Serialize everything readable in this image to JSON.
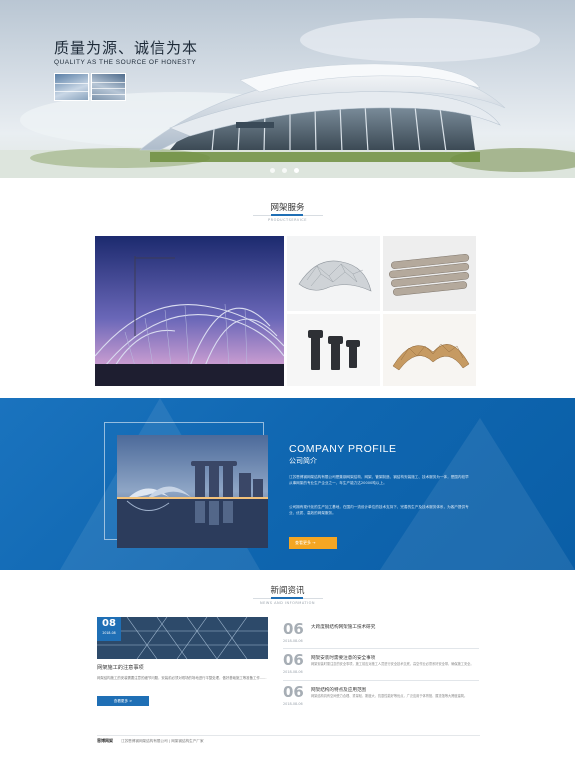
{
  "hero": {
    "title": "质量为源、诚信为本",
    "subtitle": "QUALITY AS THE SOURCE OF HONESTY",
    "thumbnails": [
      "building-photo",
      "building-photo"
    ],
    "slide_count": 3,
    "active_slide": 2
  },
  "products_section": {
    "title": "网架服务",
    "subtitle": "PRODUCTSERVICE",
    "items": [
      {
        "image": "stadium-steel-arch-photo"
      },
      {
        "image": "space-frame-model-photo"
      },
      {
        "image": "steel-pipes-photo"
      },
      {
        "image": "bolts-photo"
      },
      {
        "image": "wood-lattice-model-photo"
      }
    ]
  },
  "profile": {
    "title": "COMPANY PROFILE",
    "subtitle": "公司简介",
    "paragraph_1": "江苏恩博钢网架结构有限公司是集钢网架结构、网架、管架制造、钢结构安装施工、技术服务为一体，是国内较早从事网架的专业生产企业之一，年生产能力达20000吨以上。",
    "paragraph_2": "公司拥有现代化的生产加工基地，在国内一流设计单位的技术支持下，完善的生产及技术服务体系，为客户提供专业、优质、高效的网架服务。",
    "more_label": "查看更多 →",
    "image": "marina-bay-skyline-photo"
  },
  "news_section": {
    "title": "新闻资讯",
    "subtitle": "NEWS AND INFORMATION",
    "feature": {
      "day": "08",
      "month": "2018-08",
      "title": "网架施工的注意事项",
      "text": "网架结构施工的安装需要注意的细节问题，安装前必须对现场的场地进行平整处理，做好基础施工等准备工作……",
      "button_label": "查看更多 >",
      "image": "steel-structure-photo"
    },
    "items": [
      {
        "day": "06",
        "date": "2018-08-06",
        "title": "大跨度钢结构网架施工技术研究",
        "summary": ""
      },
      {
        "day": "06",
        "date": "2018-08-06",
        "title": "网架安装时需要注意的安全事项",
        "summary": "网架安装时需注意的安全事项，施工前应对施工人员进行安全技术交底，高空作业必须系好安全带，确保施工安全。"
      },
      {
        "day": "06",
        "date": "2018-08-06",
        "title": "网架结构的特点及应用范围",
        "summary": "网架结构具有空间受力合理、重量轻、刚度大、抗震性能好等优点，广泛应用于体育馆、展览馆等大跨度建筑。"
      }
    ]
  },
  "footer": {
    "logo": "恩博网架",
    "text": "江苏恩博钢网架结构有限公司 | 网架钢结构生产厂家"
  },
  "colors": {
    "accent_blue": "#1f6fb5",
    "profile_blue": "#0f66b0",
    "button_orange": "#f5a623"
  }
}
